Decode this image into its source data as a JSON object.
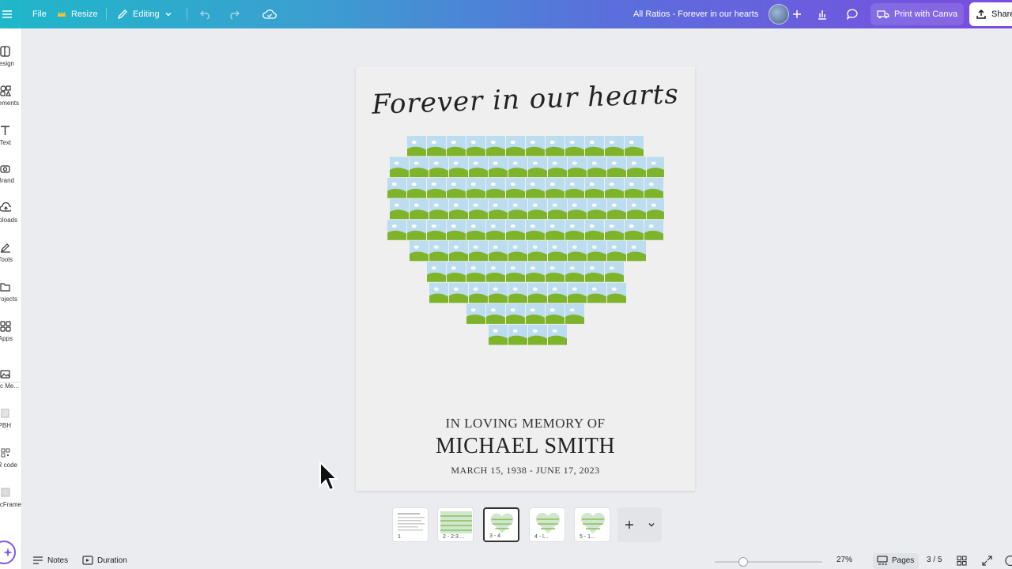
{
  "topbar": {
    "menu_icon": "hamburger-icon",
    "file_label": "File",
    "resize_label": "Resize",
    "editing_label": "Editing",
    "doc_title": "All Ratios - Forever in our hearts",
    "print_label": "Print with Canva",
    "share_label": "Share"
  },
  "rail": {
    "items": [
      {
        "label": "Design",
        "icon": "design-icon"
      },
      {
        "label": "Elements",
        "icon": "elements-icon"
      },
      {
        "label": "Text",
        "icon": "text-icon"
      },
      {
        "label": "Brand",
        "icon": "brand-icon"
      },
      {
        "label": "Uploads",
        "icon": "uploads-icon"
      },
      {
        "label": "Tools",
        "icon": "tools-icon"
      },
      {
        "label": "Projects",
        "icon": "projects-icon"
      },
      {
        "label": "Apps",
        "icon": "apps-icon"
      },
      {
        "label": "Magic Me...",
        "icon": "magic-media-icon"
      },
      {
        "label": "PBH",
        "icon": "pbh-icon"
      },
      {
        "label": "QR code",
        "icon": "qr-code-icon"
      },
      {
        "label": "PicFrame",
        "icon": "picframe-icon"
      }
    ]
  },
  "design": {
    "script_title": "Forever in our hearts",
    "memory_line": "IN LOVING MEMORY OF",
    "name": "MICHAEL SMITH",
    "dates": "MARCH 15, 1938 - JUNE 17, 2023"
  },
  "thumbnails": [
    {
      "label": "1"
    },
    {
      "label": "2 - 2:3 ..."
    },
    {
      "label": "3 - 4"
    },
    {
      "label": "4 - l..."
    },
    {
      "label": "5 - 1..."
    }
  ],
  "bottombar": {
    "notes_label": "Notes",
    "duration_label": "Duration",
    "zoom": "27%",
    "pages_label": "Pages",
    "page_count": "3 / 5"
  },
  "colors": {
    "accent": "#7c58e8",
    "sky": "#bcdcf0",
    "grass": "#7fb32a"
  }
}
